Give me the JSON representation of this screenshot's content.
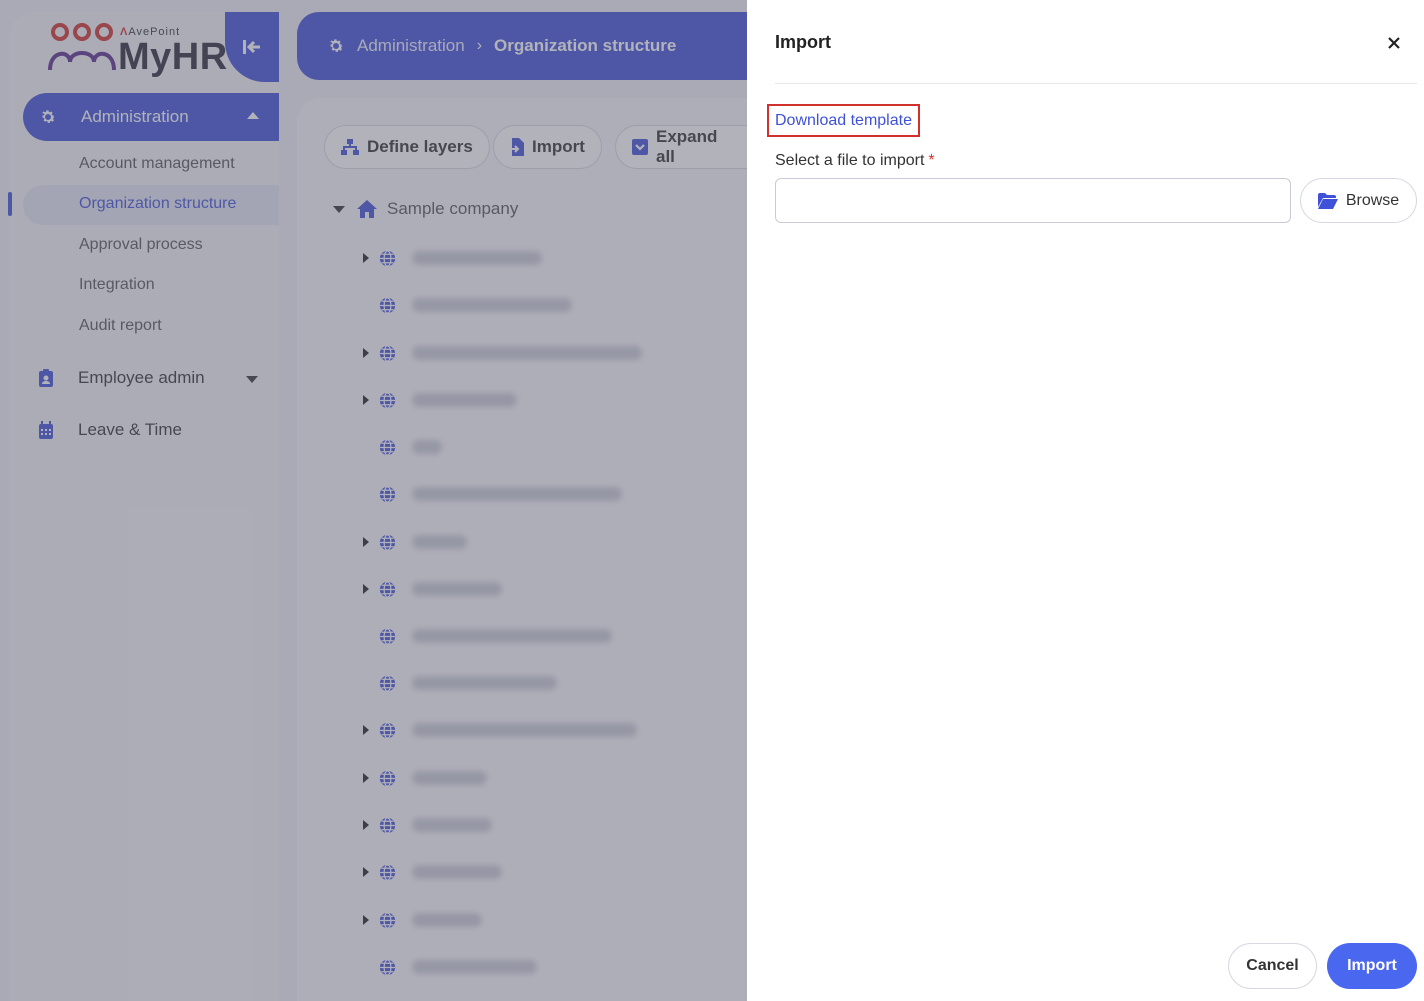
{
  "app": {
    "brand": "AvePoint",
    "name": "MyHR"
  },
  "sidebar": {
    "admin_label": "Administration",
    "admin_subitems": [
      "Account management",
      "Organization structure",
      "Approval process",
      "Integration",
      "Audit report"
    ],
    "employee_admin": "Employee admin",
    "leave_time": "Leave & Time"
  },
  "breadcrumb": {
    "root": "Administration",
    "current": "Organization structure"
  },
  "toolbar": {
    "define_layers": "Define layers",
    "import": "Import",
    "expand_all": "Expand all"
  },
  "tree": {
    "root": "Sample company"
  },
  "drawer": {
    "title": "Import",
    "download_template": "Download template",
    "file_label": "Select a file to import",
    "required_mark": "*",
    "file_value": "",
    "browse": "Browse",
    "cancel": "Cancel",
    "import": "Import"
  },
  "colors": {
    "primary": "#3f51d8",
    "button_primary": "#4a67f0",
    "required": "#d0312d"
  },
  "icons": {
    "admin": "gear-icon",
    "employee": "badge-icon",
    "leave": "calendar-icon",
    "root": "home-icon",
    "node": "globe-icon",
    "browse": "folder-open-icon",
    "close": "close-icon"
  }
}
